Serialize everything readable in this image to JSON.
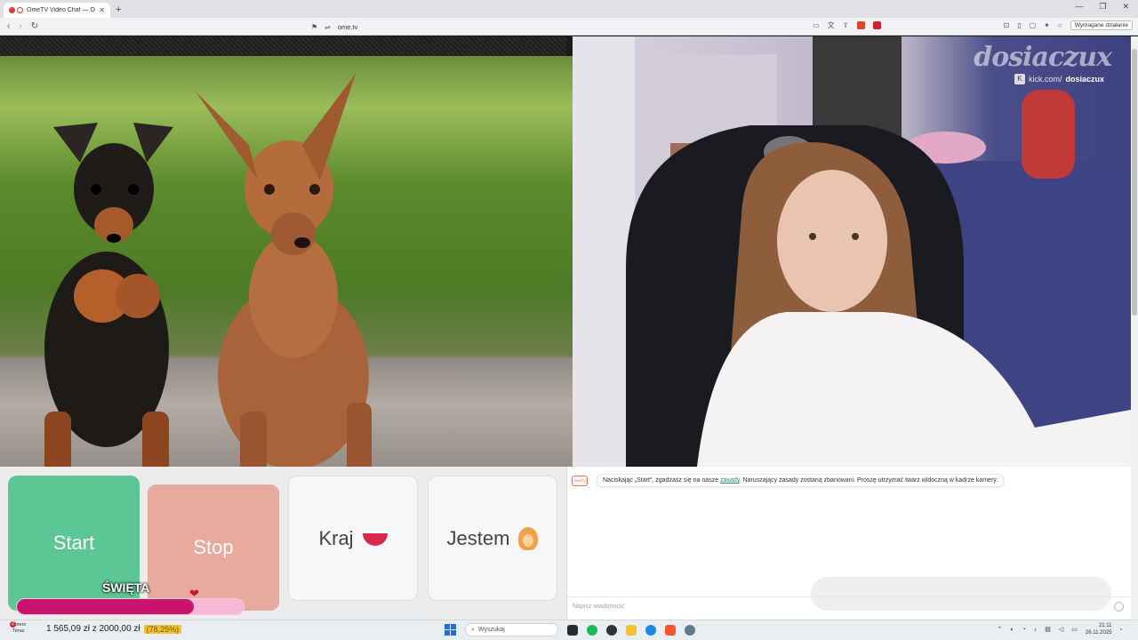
{
  "browser": {
    "tab_title": "OmeTV Video Chat — Omegle",
    "tab_close": "✕",
    "new_tab": "+",
    "window_controls": [
      "—",
      "❐",
      "✕"
    ],
    "url": "ome.tv",
    "action_required_label": "Wymagane działanie",
    "extension_badge_count": "2"
  },
  "webcam": {
    "watermark": "dosiaczux",
    "kick_prefix": "kick.com/",
    "kick_channel": "dosiaczux"
  },
  "controls": {
    "start_label": "Start",
    "stop_label": "Stop",
    "country_label": "Kraj",
    "gender_label": "Jestem"
  },
  "goal": {
    "label": "ŚWIĘTA",
    "progress": 0.78
  },
  "chat": {
    "system_icon_text": "OmeTV",
    "system_message_before": "Naciskając „Start\", zgadzasz się na nasze ",
    "system_message_link": "zasady",
    "system_message_after": ". Naruszający zasady zostaną zbanowani. Proszę utrzymać twarz widoczną w kadrze kamery.",
    "input_placeholder": "Napisz wiadomość"
  },
  "taskbar": {
    "weather_badge": "2",
    "weather_line1": "Zimno",
    "weather_line2": "Teraz",
    "money_text": "1 565,09 zł z 2000,00 zł",
    "money_percent": "(78,25%)",
    "search_placeholder": "Wyszukaj",
    "time": "21:11",
    "date": "26.11.2025"
  },
  "colors": {
    "start": "#5cc694",
    "stop": "#e7aa9c",
    "goal_fill": "#c8146c",
    "goal_track": "#f9b7d6"
  },
  "icons": [
    "back-icon",
    "forward-icon",
    "reload-icon",
    "bookmark-icon",
    "search-icon",
    "windows-logo-icon",
    "heart-icon",
    "flag-poland-icon",
    "person-emoji-icon"
  ]
}
